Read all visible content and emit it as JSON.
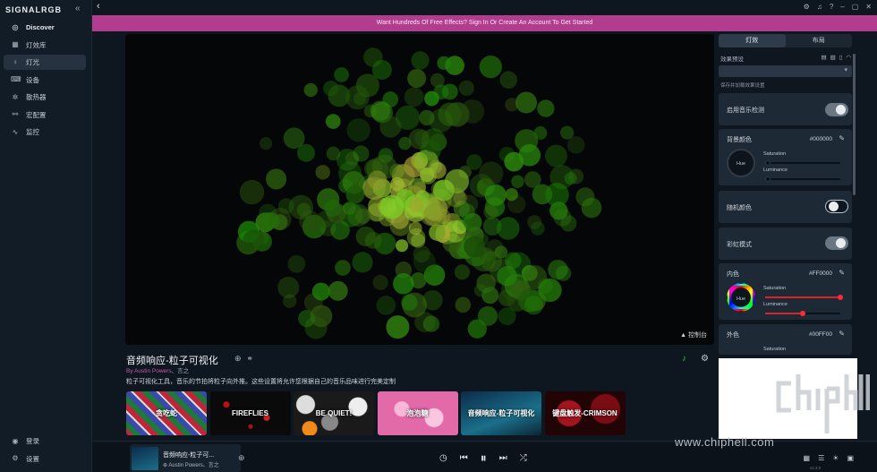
{
  "sidebar": {
    "brand": "SIGNALRGB",
    "items": [
      {
        "label": "Discover",
        "icon": "compass-icon"
      },
      {
        "label": "灯效库",
        "icon": "grid-icon"
      },
      {
        "label": "灯光",
        "icon": "bulb-icon"
      },
      {
        "label": "设备",
        "icon": "keyboard-icon"
      },
      {
        "label": "散热器",
        "icon": "fan-icon"
      },
      {
        "label": "宏配置",
        "icon": "macro-icon"
      },
      {
        "label": "监控",
        "icon": "pulse-icon"
      }
    ],
    "bottom": [
      {
        "label": "登录",
        "icon": "user-icon"
      },
      {
        "label": "设置",
        "icon": "gear-icon"
      }
    ]
  },
  "banner": "Want Hundreds Of Free Effects? Sign In Or Create An Account To Get Started",
  "preview": {
    "console_label": "▲ 控制台"
  },
  "effect": {
    "title": "音频响应-粒子可视化",
    "author_prefix": "By Austin Powers",
    "author_suffix": "、言之",
    "description": "粒子可视化工具，音乐的节拍将粒子向外推。这些设置将允许您根据自己的音乐品味进行完美定制"
  },
  "thumbnails": [
    "贪吃蛇",
    "FIREFLIES",
    "BE QUIET!",
    "泡泡糖",
    "音频响应-粒子可视化",
    "键盘触发-CRIMSON"
  ],
  "now_playing": {
    "title": "音频响应-粒子可...",
    "author": "⊕ Austin Powers、言之"
  },
  "panel": {
    "tabs": [
      "灯效",
      "布局"
    ],
    "preset_label": "效果预设",
    "preset_hint": "保存并加载效果设置",
    "music_detect": "启用音乐检测",
    "bg_color": {
      "label": "背景颜色",
      "hex": "#000000",
      "hue": "Hue",
      "saturation": "Saturation",
      "luminance": "Luminance"
    },
    "random_color": "随机颜色",
    "rainbow": "彩虹模式",
    "inner_color": {
      "label": "内色",
      "hex": "#FF0000",
      "hue": "Hue",
      "saturation": "Saturation",
      "luminance": "Luminance"
    },
    "outer_color": {
      "label": "外色",
      "hex": "#00FF00",
      "saturation": "Saturation"
    }
  },
  "toggles": {
    "music_detect": true,
    "random_color": false,
    "rainbow": true
  },
  "levels": {
    "inner_saturation": 1.0,
    "inner_luminance": 0.5
  },
  "watermark": {
    "text": "www.chiphell.com",
    "logo_text": "chip hell"
  },
  "version": "v2.3.0"
}
